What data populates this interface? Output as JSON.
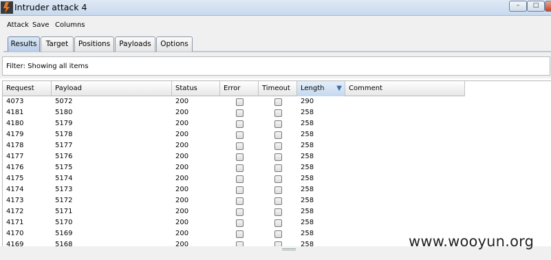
{
  "window": {
    "title": "Intruder attack 4",
    "min_glyph": "–",
    "max_glyph": "□"
  },
  "menu": [
    "Attack",
    "Save",
    "Columns"
  ],
  "tabs": [
    "Results",
    "Target",
    "Positions",
    "Payloads",
    "Options"
  ],
  "active_tab": "Results",
  "filter": {
    "text": "Filter:  Showing all items"
  },
  "table": {
    "columns": [
      "Request",
      "Payload",
      "Status",
      "Error",
      "Timeout",
      "Length",
      "Comment"
    ],
    "sorted_column": "Length",
    "sort_direction": "descending",
    "rows": [
      {
        "request": "4073",
        "payload": "5072",
        "status": "200",
        "error": false,
        "timeout": false,
        "length": "290",
        "comment": ""
      },
      {
        "request": "4181",
        "payload": "5180",
        "status": "200",
        "error": false,
        "timeout": false,
        "length": "258",
        "comment": ""
      },
      {
        "request": "4180",
        "payload": "5179",
        "status": "200",
        "error": false,
        "timeout": false,
        "length": "258",
        "comment": ""
      },
      {
        "request": "4179",
        "payload": "5178",
        "status": "200",
        "error": false,
        "timeout": false,
        "length": "258",
        "comment": ""
      },
      {
        "request": "4178",
        "payload": "5177",
        "status": "200",
        "error": false,
        "timeout": false,
        "length": "258",
        "comment": ""
      },
      {
        "request": "4177",
        "payload": "5176",
        "status": "200",
        "error": false,
        "timeout": false,
        "length": "258",
        "comment": ""
      },
      {
        "request": "4176",
        "payload": "5175",
        "status": "200",
        "error": false,
        "timeout": false,
        "length": "258",
        "comment": ""
      },
      {
        "request": "4175",
        "payload": "5174",
        "status": "200",
        "error": false,
        "timeout": false,
        "length": "258",
        "comment": ""
      },
      {
        "request": "4174",
        "payload": "5173",
        "status": "200",
        "error": false,
        "timeout": false,
        "length": "258",
        "comment": ""
      },
      {
        "request": "4173",
        "payload": "5172",
        "status": "200",
        "error": false,
        "timeout": false,
        "length": "258",
        "comment": ""
      },
      {
        "request": "4172",
        "payload": "5171",
        "status": "200",
        "error": false,
        "timeout": false,
        "length": "258",
        "comment": ""
      },
      {
        "request": "4171",
        "payload": "5170",
        "status": "200",
        "error": false,
        "timeout": false,
        "length": "258",
        "comment": ""
      },
      {
        "request": "4170",
        "payload": "5169",
        "status": "200",
        "error": false,
        "timeout": false,
        "length": "258",
        "comment": ""
      },
      {
        "request": "4169",
        "payload": "5168",
        "status": "200",
        "error": false,
        "timeout": false,
        "length": "258",
        "comment": ""
      }
    ]
  },
  "watermark": "www.wooyun.org",
  "colors": {
    "title_bg": "#d5e3f3",
    "active_tab": "#c9dbef",
    "sort_arrow": "#3e6c9e",
    "app_icon": "#e8792b"
  },
  "icons": {
    "app": "burp-logo-icon",
    "sort": "sort-descending-icon"
  }
}
